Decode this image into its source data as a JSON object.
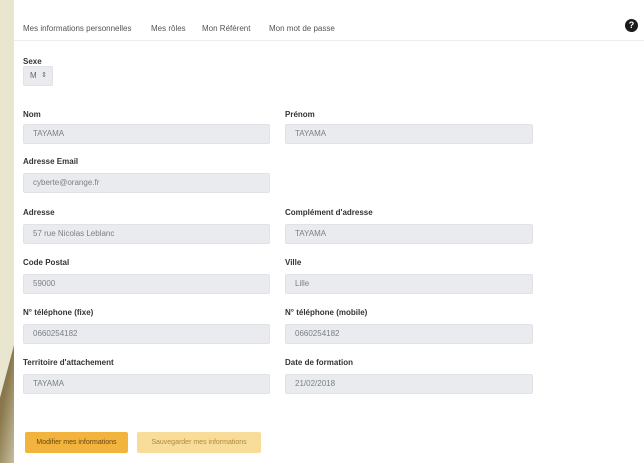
{
  "tabs": [
    {
      "label": "Mes informations personnelles"
    },
    {
      "label": "Mes rôles"
    },
    {
      "label": "Mon Référent"
    },
    {
      "label": "Mon mot de passe"
    }
  ],
  "help_icon": "?",
  "form": {
    "sexe": {
      "label": "Sexe",
      "value": "M"
    },
    "nom": {
      "label": "Nom",
      "value": "TAYAMA"
    },
    "prenom": {
      "label": "Prénom",
      "value": "TAYAMA"
    },
    "email": {
      "label": "Adresse Email",
      "value": "cyberte@orange.fr"
    },
    "adresse": {
      "label": "Adresse",
      "value": "57 rue Nicolas Leblanc"
    },
    "complement": {
      "label": "Complément d'adresse",
      "value": "TAYAMA"
    },
    "code_postal": {
      "label": "Code Postal",
      "value": "59000"
    },
    "ville": {
      "label": "Ville",
      "value": "Lille"
    },
    "tel_fixe": {
      "label": "N° téléphone (fixe)",
      "value": "0660254182"
    },
    "tel_mobile": {
      "label": "N° téléphone (mobile)",
      "value": "0660254182"
    },
    "territoire": {
      "label": "Territoire d'attachement",
      "value": "TAYAMA"
    },
    "date_formation": {
      "label": "Date de formation",
      "value": "21/02/2018"
    }
  },
  "buttons": {
    "modify": "Modifier mes informations",
    "save": "Sauvegarder mes informations"
  }
}
